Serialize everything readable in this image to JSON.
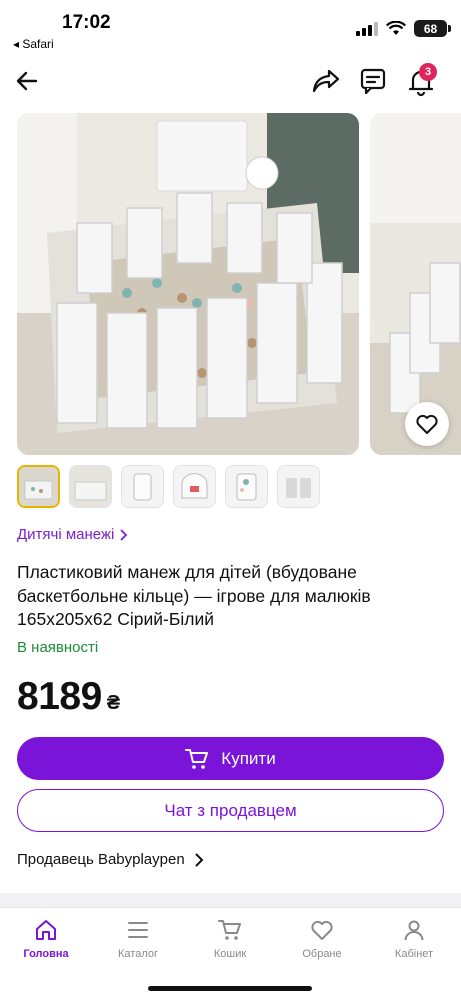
{
  "status_bar": {
    "time": "17:02",
    "back_app": "◂ Safari",
    "battery": "68"
  },
  "nav": {
    "notifications_count": "3"
  },
  "product": {
    "category": "Дитячі манежі",
    "title": "Пластиковий манеж для дітей (вбудоване баскетбольне кільце) — ігрове для малюків 165х205х62 Сірий-Білий",
    "stock": "В наявності",
    "price": "8189",
    "currency": "₴"
  },
  "actions": {
    "buy_label": "Купити",
    "chat_label": "Чат з продавцем"
  },
  "seller": {
    "label": "Продавець Babyplaypen"
  },
  "tabs": [
    {
      "label": "Головна",
      "icon": "home-icon",
      "active": true
    },
    {
      "label": "Каталог",
      "icon": "menu-icon",
      "active": false
    },
    {
      "label": "Кошик",
      "icon": "cart-icon",
      "active": false
    },
    {
      "label": "Обране",
      "icon": "heart-icon",
      "active": false
    },
    {
      "label": "Кабінет",
      "icon": "user-icon",
      "active": false
    }
  ],
  "colors": {
    "accent": "#7a14d8",
    "in_stock": "#1f8a3a",
    "badge": "#e0245e",
    "thumb_selected": "#e8b400"
  }
}
